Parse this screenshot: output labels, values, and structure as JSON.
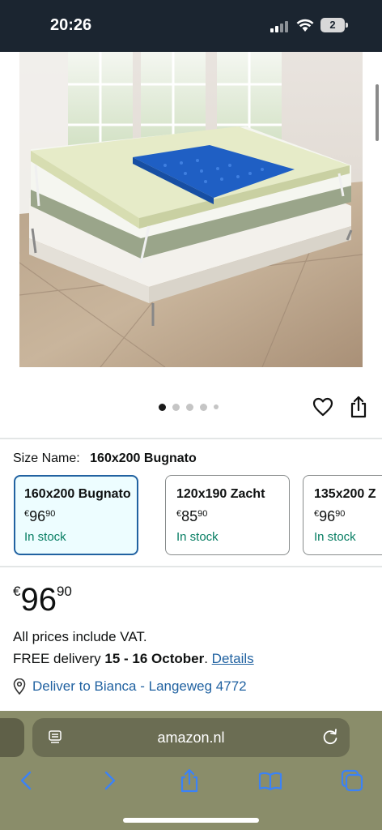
{
  "status": {
    "time": "20:26",
    "battery": "2"
  },
  "product": {
    "image_alt": "mattress-topper-photo",
    "dots_total": 5,
    "dots_active": 0
  },
  "size": {
    "label": "Size Name:",
    "selected": "160x200 Bugnato",
    "options": [
      {
        "name": "160x200 Bugnato",
        "currency": "€",
        "whole": "96",
        "cents": "90",
        "stock": "In stock"
      },
      {
        "name": "120x190 Zacht",
        "currency": "€",
        "whole": "85",
        "cents": "90",
        "stock": "In stock"
      },
      {
        "name": "135x200 Z",
        "currency": "€",
        "whole": "96",
        "cents": "90",
        "stock": "In stock"
      }
    ]
  },
  "price": {
    "currency": "€",
    "whole": "96",
    "cents": "90"
  },
  "vat_text": "All prices include VAT.",
  "delivery": {
    "prefix": "FREE delivery",
    "dates": "15 - 16 October",
    "suffix": ".",
    "details_link": "Details"
  },
  "deliver_to": "Deliver to Bianca - Langeweg 4772",
  "browser": {
    "url": "amazon.nl"
  },
  "colors": {
    "accent_link": "#2162a1",
    "in_stock": "#067d62",
    "selected_border": "#2162a1",
    "browser_bar": "#8a8d6a"
  }
}
